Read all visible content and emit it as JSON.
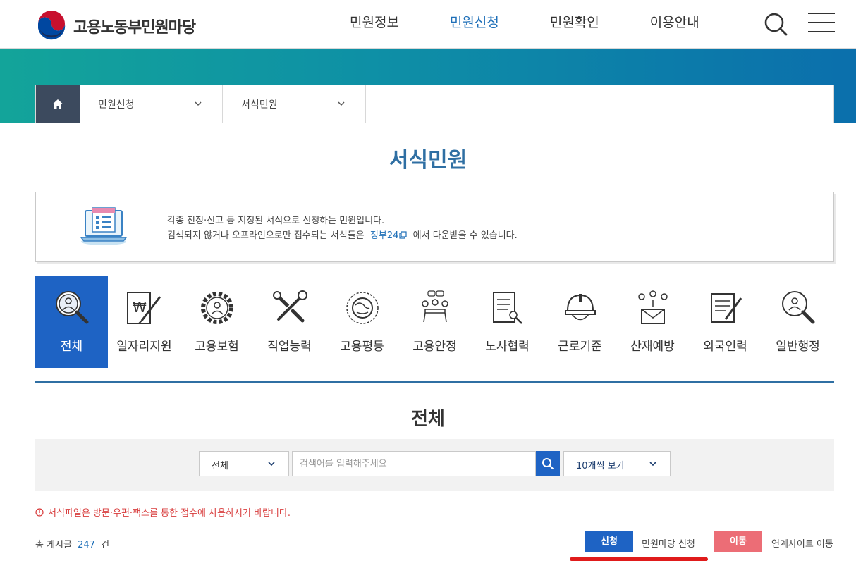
{
  "header": {
    "logo_text": "고용노동부민원마당",
    "nav": [
      {
        "label": "민원정보",
        "active": false
      },
      {
        "label": "민원신청",
        "active": true
      },
      {
        "label": "민원확인",
        "active": false
      },
      {
        "label": "이용안내",
        "active": false
      }
    ]
  },
  "breadcrumb": {
    "level1": "민원신청",
    "level2": "서식민원"
  },
  "page_title": "서식민원",
  "info": {
    "line1": "각종 진정·신고 등 지정된 서식으로 신청하는 민원입니다.",
    "line2_prefix": "검색되지 않거나 오프라인으로만 접수되는 서식들은",
    "link_text": "정부24",
    "line2_suffix": "에서 다운받을 수 있습니다."
  },
  "categories": [
    {
      "label": "전체",
      "icon": "search-person-icon",
      "active": true
    },
    {
      "label": "일자리지원",
      "icon": "document-won-icon",
      "active": false
    },
    {
      "label": "고용보험",
      "icon": "gear-person-icon",
      "active": false
    },
    {
      "label": "직업능력",
      "icon": "tools-icon",
      "active": false
    },
    {
      "label": "고용평등",
      "icon": "cycle-globe-icon",
      "active": false
    },
    {
      "label": "고용안정",
      "icon": "meeting-icon",
      "active": false
    },
    {
      "label": "노사협력",
      "icon": "document-pen-icon",
      "active": false
    },
    {
      "label": "근로기준",
      "icon": "helmet-icon",
      "active": false
    },
    {
      "label": "산재예방",
      "icon": "people-mail-icon",
      "active": false
    },
    {
      "label": "외국인력",
      "icon": "form-pen-icon",
      "active": false
    },
    {
      "label": "일반행정",
      "icon": "magnifier-person-icon",
      "active": false
    }
  ],
  "section_title": "전체",
  "search": {
    "scope_value": "전체",
    "placeholder": "검색어를 입력해주세요",
    "page_size_value": "10개씩 보기"
  },
  "notice": "서식파일은 방문·우편·팩스를 통한 접수에 사용하시기 바랍니다.",
  "total": {
    "prefix": "총 게시글",
    "count": "247",
    "suffix": "건"
  },
  "legend": {
    "apply_label": "신청",
    "apply_desc": "민원마당 신청",
    "move_label": "이동",
    "move_desc": "연계사이트 이동"
  },
  "colors": {
    "accent": "#1e63c4",
    "title_blue": "#2f6fa3",
    "move_red": "#ec6d76",
    "notice_red": "#d83c3c"
  }
}
